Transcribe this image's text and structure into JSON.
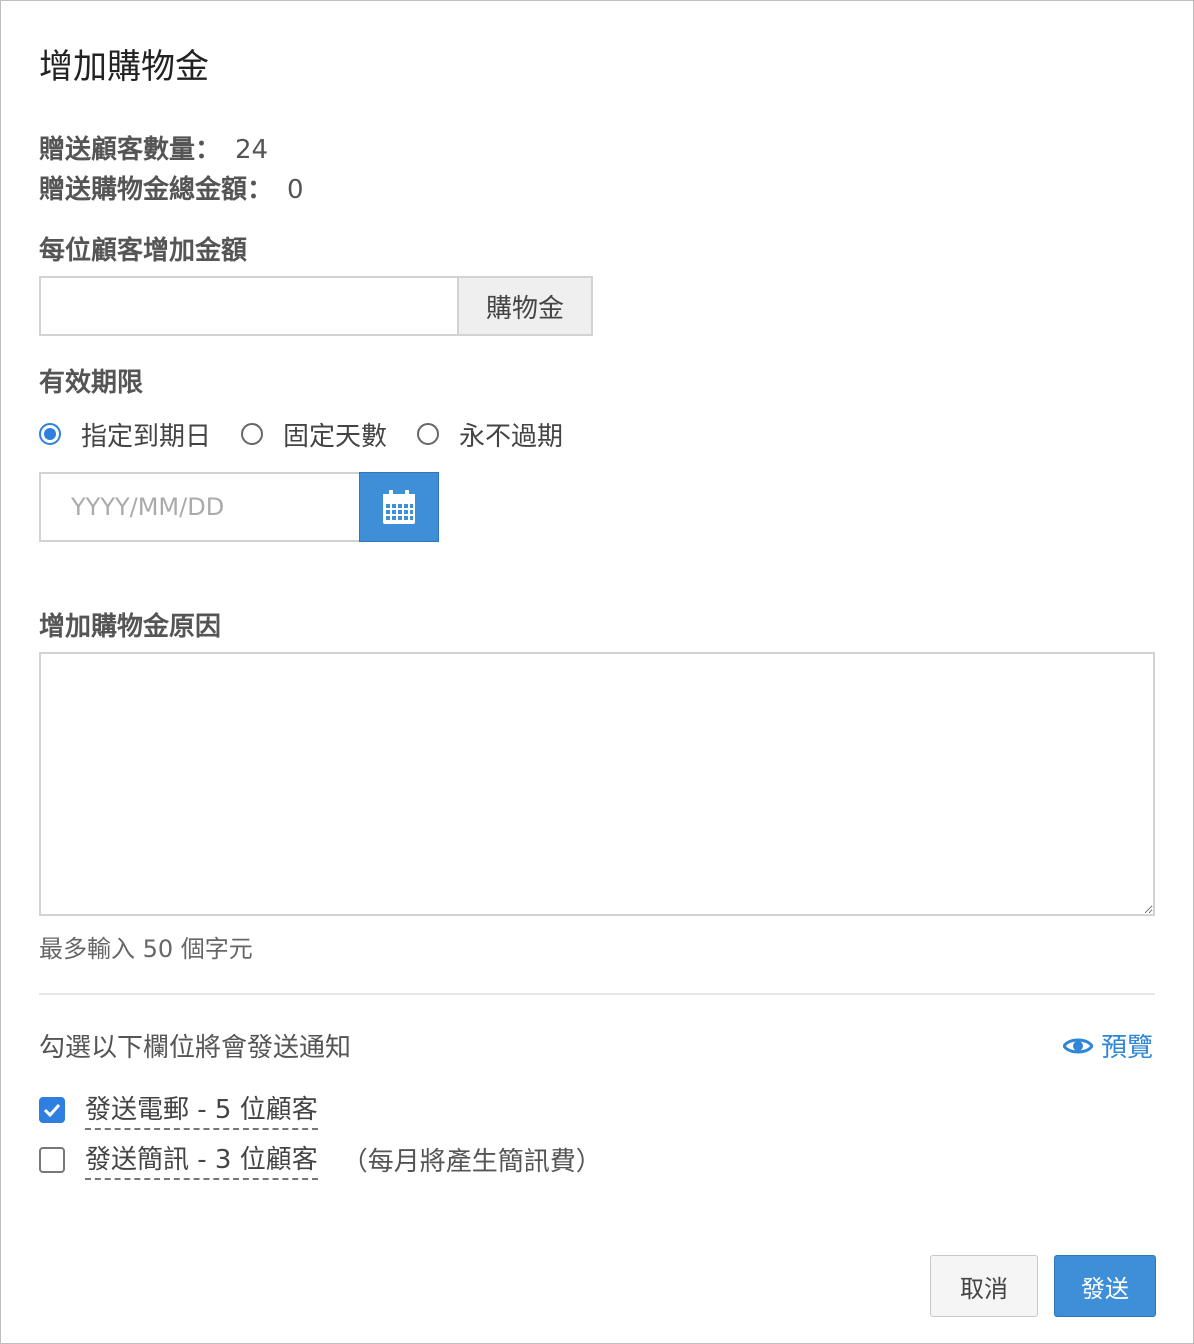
{
  "dialog": {
    "title": "增加購物金"
  },
  "summary": {
    "customer_count_label": "贈送顧客數量：",
    "customer_count_value": "24",
    "total_amount_label": "贈送購物金總金額：",
    "total_amount_value": "0"
  },
  "amount": {
    "label": "每位顧客增加金額",
    "value": "",
    "addon": "購物金"
  },
  "expiry": {
    "label": "有效期限",
    "options": [
      {
        "label": "指定到期日",
        "selected": true
      },
      {
        "label": "固定天數",
        "selected": false
      },
      {
        "label": "永不過期",
        "selected": false
      }
    ],
    "date_placeholder": "YYYY/MM/DD",
    "calendar_icon": "calendar-icon"
  },
  "reason": {
    "label": "增加購物金原因",
    "value": "",
    "hint": "最多輸入 50 個字元"
  },
  "notification": {
    "label": "勾選以下欄位將會發送通知",
    "preview_label": "預覽",
    "preview_icon": "eye-icon",
    "email": {
      "label": "發送電郵 - 5 位顧客",
      "checked": true
    },
    "sms": {
      "label": "發送簡訊 - 3 位顧客",
      "note": "（每月將產生簡訊費）",
      "checked": false
    }
  },
  "buttons": {
    "cancel": "取消",
    "send": "發送"
  },
  "colors": {
    "accent": "#3f8fd8",
    "link": "#2f86d6"
  }
}
